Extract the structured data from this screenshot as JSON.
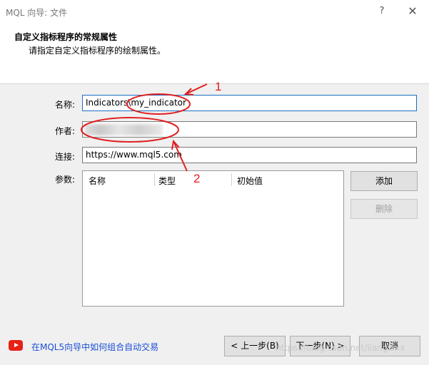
{
  "window": {
    "title": "MQL 向导: 文件",
    "help_glyph": "?",
    "close_glyph": "✕"
  },
  "header": {
    "title": "自定义指标程序的常规属性",
    "subtitle": "请指定自定义指标程序的绘制属性。"
  },
  "form": {
    "name_label": "名称:",
    "name_value": "Indicators\\my_indicator",
    "author_label": "作者:",
    "author_value": "",
    "link_label": "连接:",
    "link_value": "https://www.mql5.com",
    "params_label": "参数:",
    "params_columns": [
      "名称",
      "类型",
      "初始值"
    ]
  },
  "buttons": {
    "add": "添加",
    "delete": "删除",
    "back": "< 上一步(B)",
    "next": "下一步(N) >",
    "cancel": "取消"
  },
  "footer": {
    "help_link": "在MQL5向导中如何组合自动交易",
    "watermark": "https://blog.csdn.net/liangzixx"
  },
  "annotations": {
    "label_1": "1",
    "label_2": "2",
    "color": "#e02020"
  },
  "icons": [
    "question-icon",
    "close-icon",
    "youtube-icon"
  ]
}
